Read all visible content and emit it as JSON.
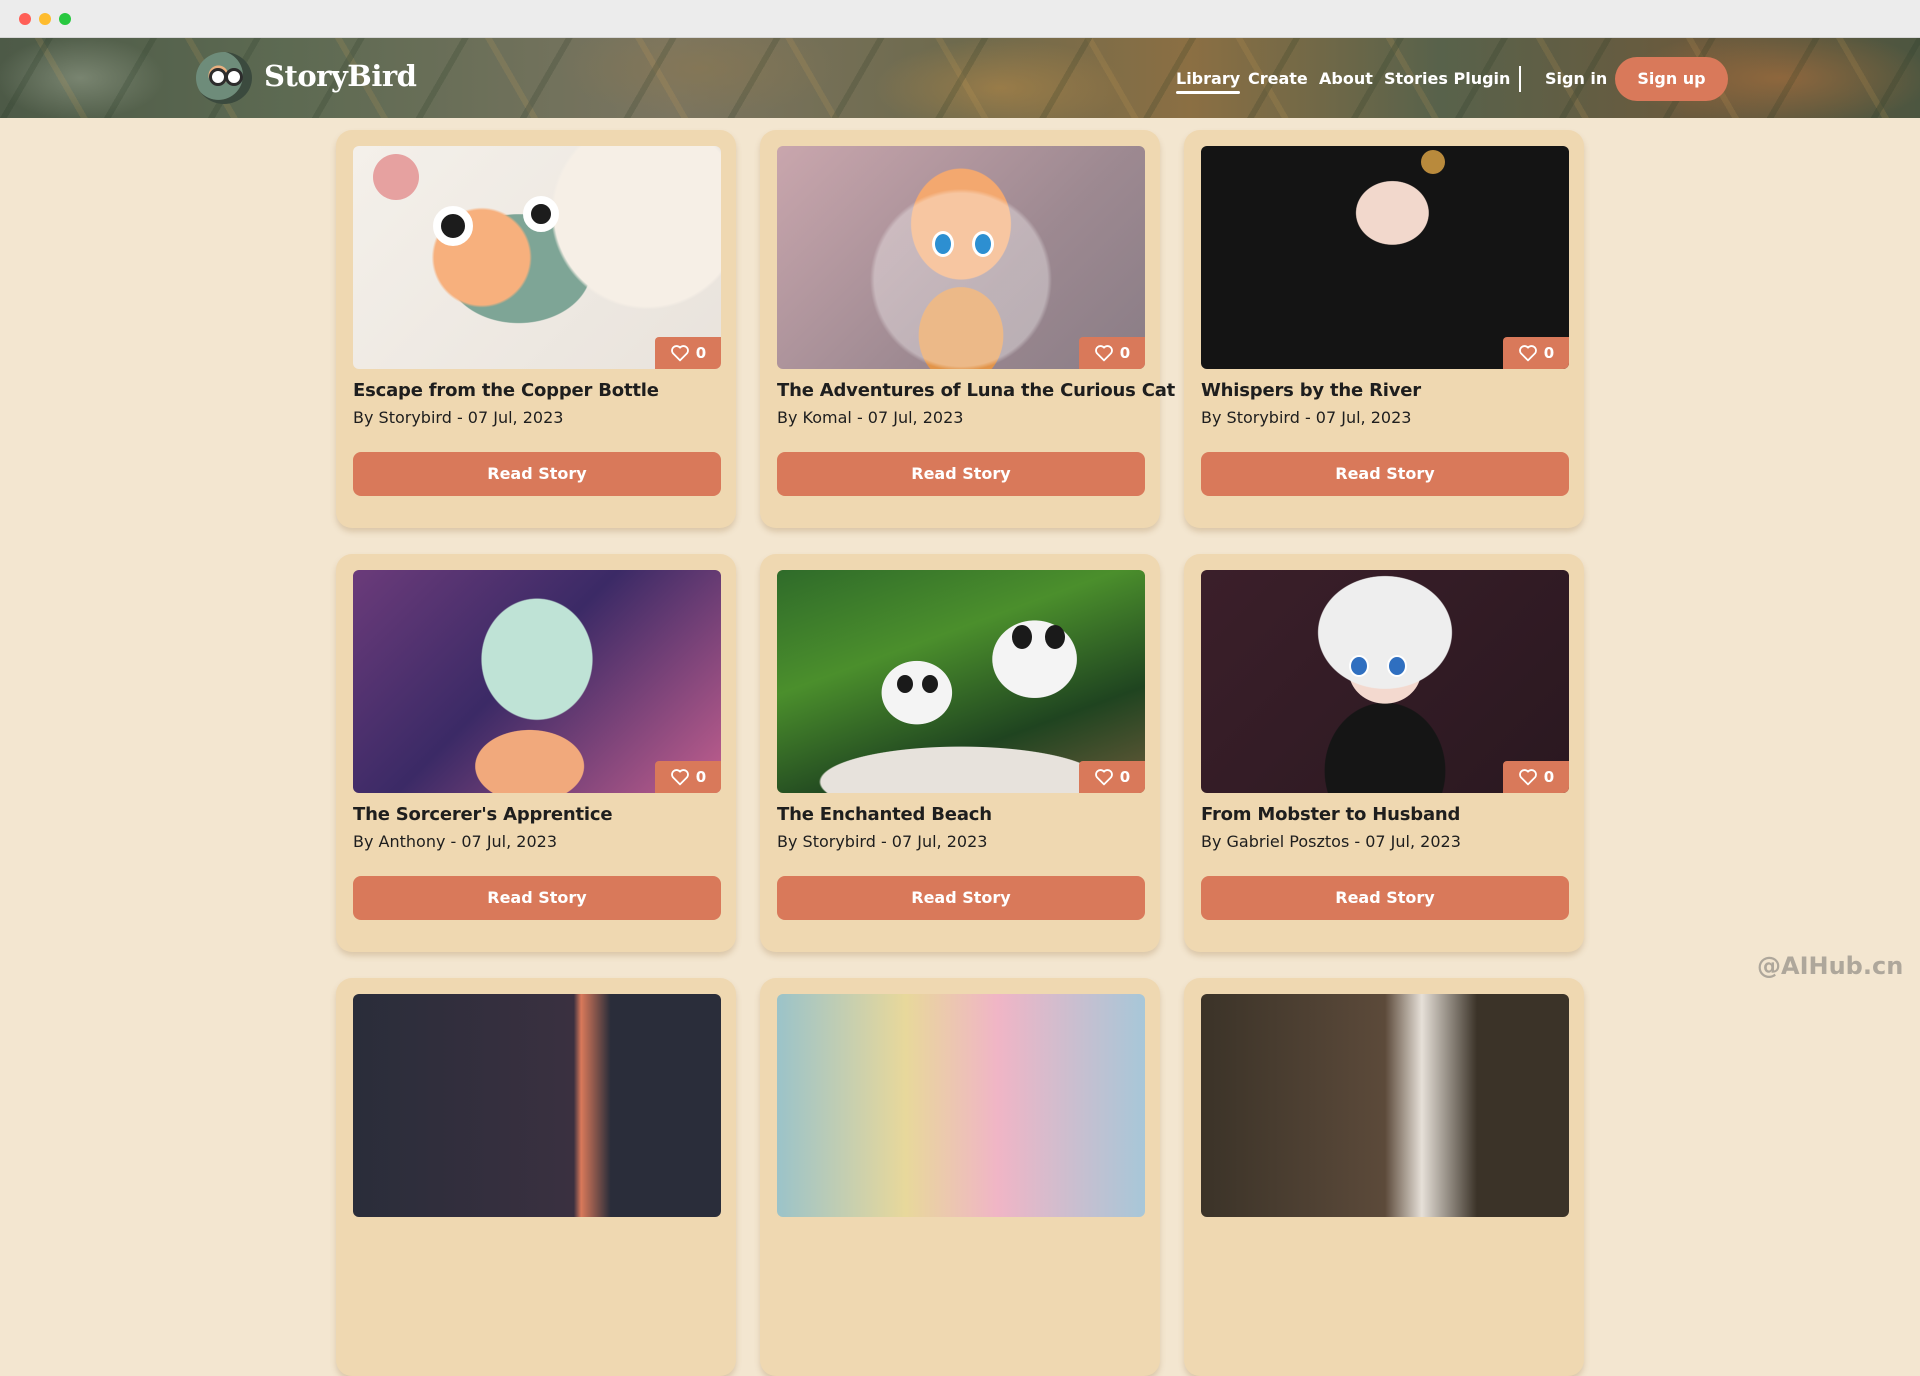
{
  "nav": {
    "brand": "StoryBird",
    "links": [
      "Library",
      "Create",
      "About",
      "Stories Plugin"
    ],
    "sign_in": "Sign in",
    "sign_up": "Sign up"
  },
  "stories": [
    {
      "title": "Escape from the Copper Bottle",
      "meta": "By Storybird - 07 Jul, 2023",
      "likes": "0",
      "button": "Read Story"
    },
    {
      "title": "The Adventures of Luna the Curious Cat",
      "meta": "By Komal - 07 Jul, 2023",
      "likes": "0",
      "button": "Read Story"
    },
    {
      "title": "Whispers by the River",
      "meta": "By Storybird - 07 Jul, 2023",
      "likes": "0",
      "button": "Read Story"
    },
    {
      "title": "The Sorcerer's Apprentice",
      "meta": "By Anthony - 07 Jul, 2023",
      "likes": "0",
      "button": "Read Story"
    },
    {
      "title": "The Enchanted Beach",
      "meta": "By Storybird - 07 Jul, 2023",
      "likes": "0",
      "button": "Read Story"
    },
    {
      "title": "From Mobster to Husband",
      "meta": "By Gabriel Posztos - 07 Jul, 2023",
      "likes": "0",
      "button": "Read Story"
    }
  ],
  "watermark": "@AIHub.cn",
  "colors": {
    "accent": "#d9795a",
    "background": "#f3e6d0",
    "card": "#efd8b1"
  }
}
